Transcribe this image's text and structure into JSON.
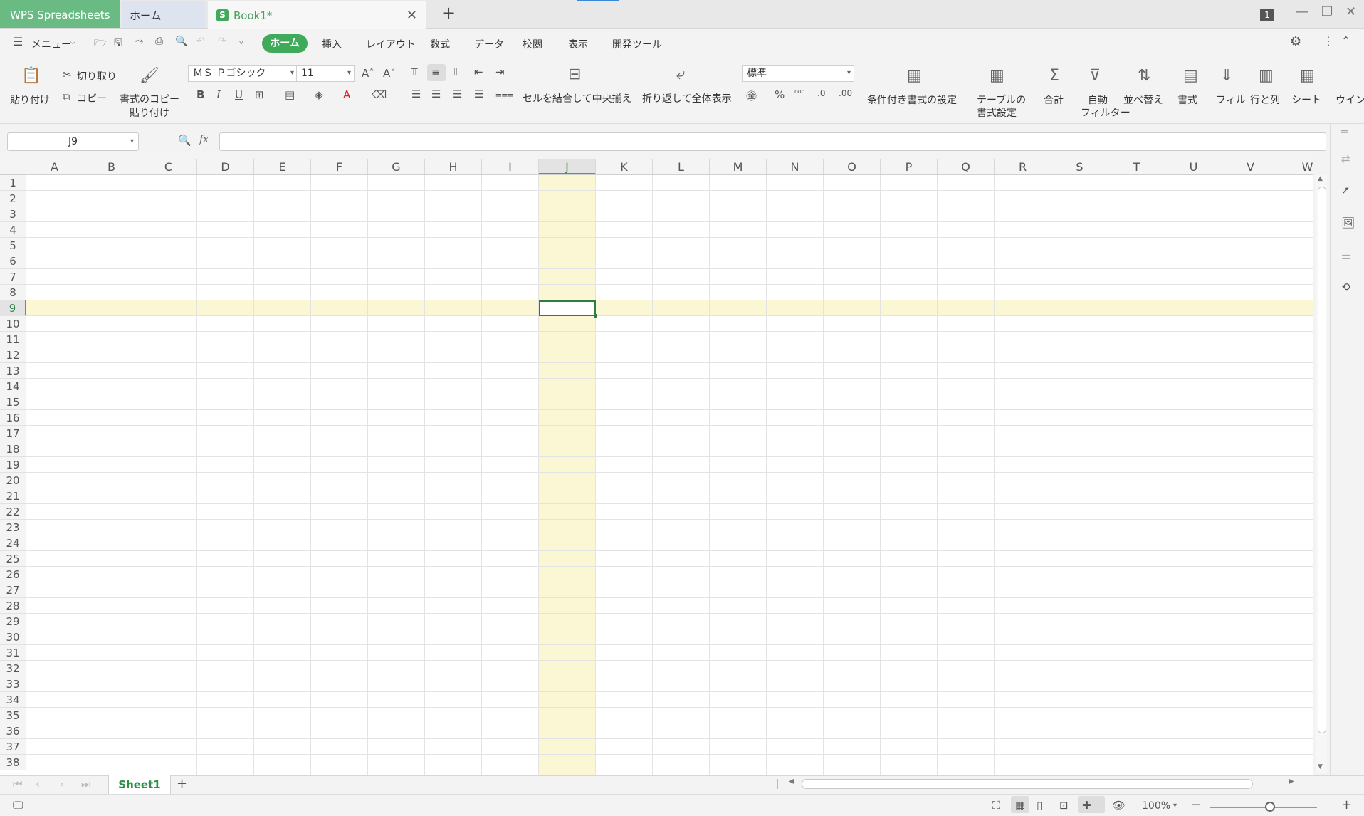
{
  "titlebar": {
    "app_tab": "WPS Spreadsheets",
    "home_tab": "ホーム",
    "doc_tab": "Book1*",
    "doc_tab_icon": "S",
    "close_glyph": "✕",
    "new_tab_glyph": "+",
    "notif_count": "1"
  },
  "menubar": {
    "menu_label": "メニュー",
    "tabs": [
      "ホーム",
      "挿入",
      "レイアウト",
      "数式",
      "データ",
      "校閲",
      "表示",
      "開発ツール"
    ]
  },
  "ribbon": {
    "paste": "貼り付け",
    "cut": "切り取り",
    "copy": "コピー",
    "format_painter_line1": "書式のコピー",
    "format_painter_line2": "貼り付け",
    "font_name": "ＭＳ Ｐゴシック",
    "font_size": "11",
    "merge_center": "セルを結合して中央揃え",
    "wrap_text": "折り返して全体表示",
    "number_format": "標準",
    "conditional_format": "条件付き書式の設定",
    "table_format_line1": "テーブルの",
    "table_format_line2": "書式設定",
    "sum": "合計",
    "autofilter_line1": "自動",
    "autofilter_line2": "フィルター",
    "sort": "並べ替え",
    "format": "書式",
    "fill": "フィル",
    "rows_cols": "行と列",
    "sheet": "シート",
    "window": "ウイン"
  },
  "formula": {
    "name_box": "J9",
    "fx": "fx",
    "content": ""
  },
  "grid": {
    "columns": [
      "A",
      "B",
      "C",
      "D",
      "E",
      "F",
      "G",
      "H",
      "I",
      "J",
      "K",
      "L",
      "M",
      "N",
      "O",
      "P",
      "Q",
      "R",
      "S",
      "T",
      "U",
      "V",
      "W"
    ],
    "rows": [
      "1",
      "2",
      "3",
      "4",
      "5",
      "6",
      "7",
      "8",
      "9",
      "10",
      "11",
      "12",
      "13",
      "14",
      "15",
      "16",
      "17",
      "18",
      "19",
      "20",
      "21",
      "22",
      "23",
      "24",
      "25",
      "26",
      "27",
      "28",
      "29",
      "30",
      "31",
      "32",
      "33",
      "34",
      "35",
      "36",
      "37",
      "38"
    ],
    "selected_column": "J",
    "selected_row": "9",
    "highlight_color": "#fbf7d5",
    "selection_color": "#2f7d3f"
  },
  "sheets": {
    "tabs": [
      "Sheet1"
    ],
    "add_glyph": "+"
  },
  "status": {
    "zoom": "100%"
  },
  "colors": {
    "accent": "#3fab5a",
    "app_tab_bg": "#6aba84"
  }
}
